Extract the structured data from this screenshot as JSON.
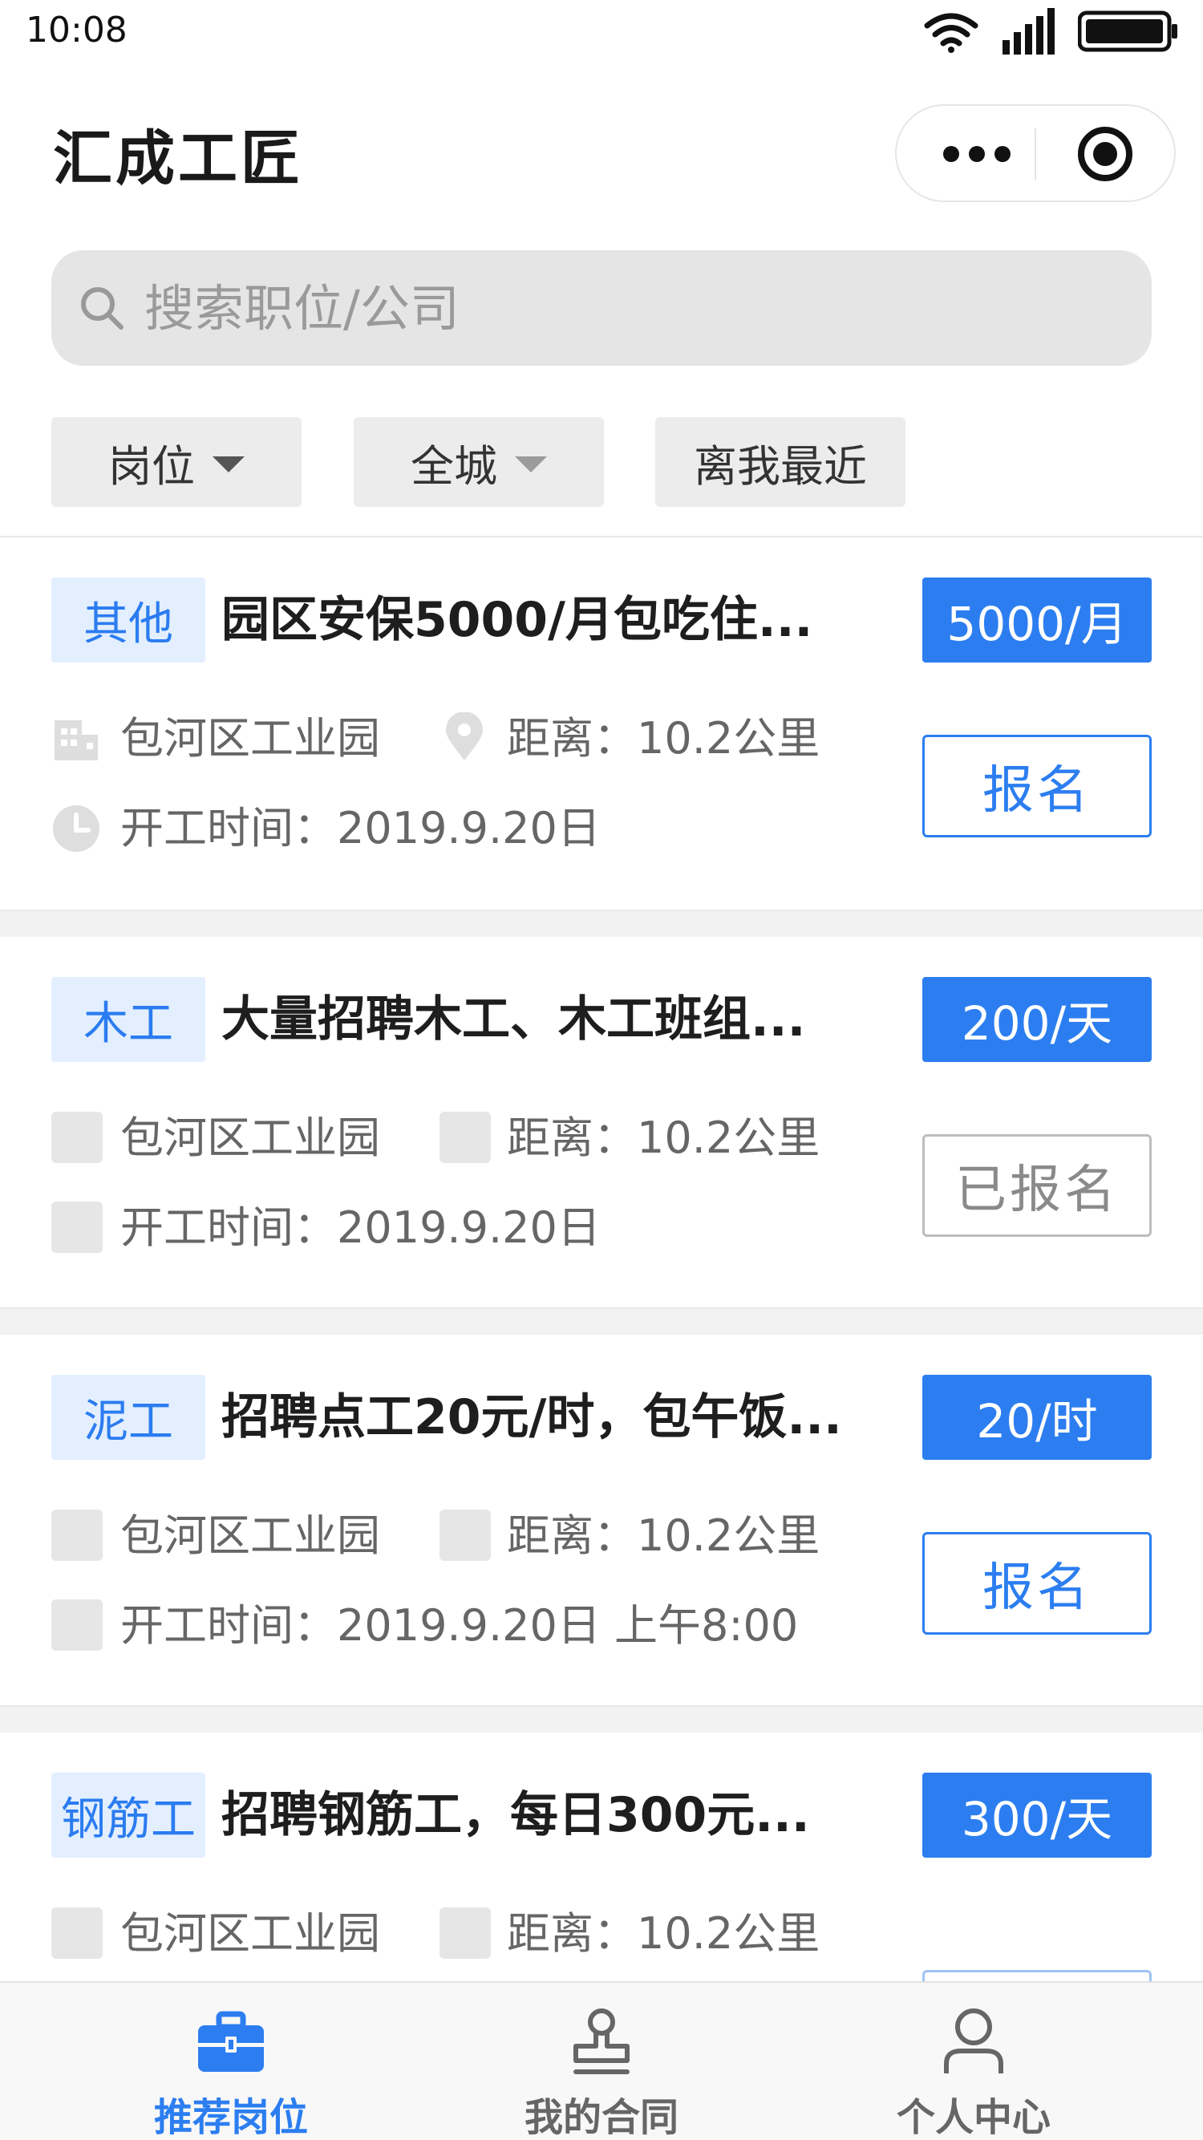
{
  "status_bar": {
    "time": "10:08"
  },
  "nav": {
    "title": "汇成工匠"
  },
  "search": {
    "placeholder": "搜索职位/公司"
  },
  "filters": [
    {
      "label": "岗位"
    },
    {
      "label": "全城"
    },
    {
      "label": "离我最近"
    }
  ],
  "jobs": [
    {
      "tag": "其他",
      "title": "园区安保5000/月包吃住...",
      "salary": "5000/月",
      "location": "包河区工业园",
      "distance": "距离：10.2公里",
      "start_time": "开工时间：2019.9.20日",
      "action": "报名"
    },
    {
      "tag": "木工",
      "title": "大量招聘木工、木工班组...",
      "salary": "200/天",
      "location": "包河区工业园",
      "distance": "距离：10.2公里",
      "start_time": "开工时间：2019.9.20日",
      "action": "已报名"
    },
    {
      "tag": "泥工",
      "title": "招聘点工20元/时，包午饭...",
      "salary": "20/时",
      "location": "包河区工业园",
      "distance": "距离：10.2公里",
      "start_time": "开工时间：2019.9.20日 上午8:00",
      "action": "报名"
    },
    {
      "tag": "钢筋工",
      "title": "招聘钢筋工，每日300元...",
      "salary": "300/天",
      "location": "包河区工业园",
      "distance": "距离：10.2公里"
    }
  ],
  "tab_bar": {
    "items": [
      {
        "label": "推荐岗位",
        "icon": "briefcase-icon",
        "active": true
      },
      {
        "label": "我的合同",
        "icon": "stamp-icon",
        "active": false
      },
      {
        "label": "个人中心",
        "icon": "person-icon",
        "active": false
      }
    ]
  },
  "colors": {
    "accent": "#2c7ef0",
    "tag_bg": "#e3efff",
    "search_bg": "#e5e5e5"
  }
}
